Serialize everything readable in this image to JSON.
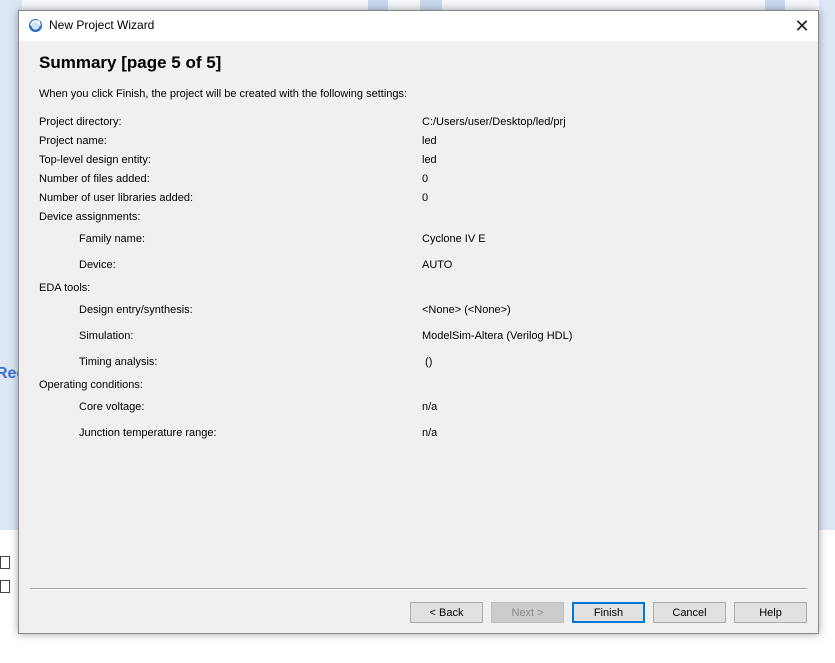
{
  "window": {
    "title": "New Project Wizard",
    "close_label": "✕"
  },
  "page": {
    "heading": "Summary [page 5 of 5]",
    "intro": "When you click Finish, the project will be created with the following settings:"
  },
  "settings": {
    "project_directory": {
      "label": "Project directory:",
      "value": "C:/Users/user/Desktop/led/prj"
    },
    "project_name": {
      "label": "Project name:",
      "value": "led"
    },
    "top_level_entity": {
      "label": "Top-level design entity:",
      "value": "led"
    },
    "files_added": {
      "label": "Number of files added:",
      "value": "0"
    },
    "user_libraries_added": {
      "label": "Number of user libraries added:",
      "value": "0"
    },
    "device_assignments": {
      "label": "Device assignments:"
    },
    "family_name": {
      "label": "Family name:",
      "value": "Cyclone IV E"
    },
    "device": {
      "label": "Device:",
      "value": "AUTO"
    },
    "eda_tools": {
      "label": "EDA tools:"
    },
    "design_entry": {
      "label": "Design entry/synthesis:",
      "value": "<None> (<None>)"
    },
    "simulation": {
      "label": "Simulation:",
      "value": "ModelSim-Altera (Verilog HDL)"
    },
    "timing_analysis": {
      "label": "Timing analysis:",
      "value": " ()"
    },
    "operating_conditions": {
      "label": "Operating conditions:"
    },
    "core_voltage": {
      "label": "Core voltage:",
      "value": "n/a"
    },
    "junction_temp": {
      "label": "Junction temperature range:",
      "value": "n/a"
    }
  },
  "buttons": {
    "back": "< Back",
    "next": "Next >",
    "finish": "Finish",
    "cancel": "Cancel",
    "help": "Help"
  },
  "background": {
    "partial_text": "Rec"
  },
  "colors": {
    "dialog_bg": "#f0f0f0",
    "default_button_border": "#0078d7"
  }
}
